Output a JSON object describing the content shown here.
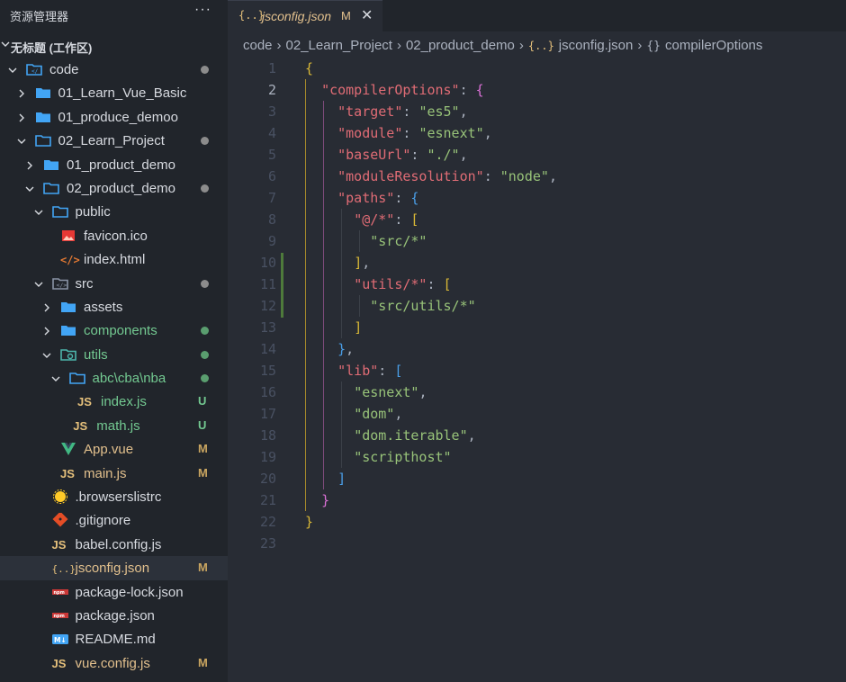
{
  "sidebar": {
    "title": "资源管理器",
    "more": "···",
    "workspace": "无标题 (工作区)",
    "items": [
      {
        "label": "code",
        "indent": 0,
        "chevron": "down",
        "icon": "folder-code",
        "color": "",
        "mark": "dot-gray"
      },
      {
        "label": "01_Learn_Vue_Basic",
        "indent": 1,
        "chevron": "right",
        "icon": "folder",
        "mark": ""
      },
      {
        "label": "01_produce_demoo",
        "indent": 1,
        "chevron": "right",
        "icon": "folder",
        "mark": ""
      },
      {
        "label": "02_Learn_Project",
        "indent": 1,
        "chevron": "down",
        "icon": "folder-open",
        "mark": "dot-gray"
      },
      {
        "label": "01_product_demo",
        "indent": 2,
        "chevron": "right",
        "icon": "folder",
        "mark": ""
      },
      {
        "label": "02_product_demo",
        "indent": 2,
        "chevron": "down",
        "icon": "folder-open",
        "mark": "dot-gray"
      },
      {
        "label": "public",
        "indent": 3,
        "chevron": "down",
        "icon": "folder-open",
        "mark": ""
      },
      {
        "label": "favicon.ico",
        "indent": 4,
        "chevron": "",
        "icon": "image",
        "mark": ""
      },
      {
        "label": "index.html",
        "indent": 4,
        "chevron": "",
        "icon": "html",
        "mark": ""
      },
      {
        "label": "src",
        "indent": 3,
        "chevron": "down",
        "icon": "folder-src",
        "mark": "dot-gray"
      },
      {
        "label": "assets",
        "indent": 4,
        "chevron": "right",
        "icon": "folder",
        "mark": ""
      },
      {
        "label": "components",
        "indent": 4,
        "chevron": "right",
        "icon": "folder",
        "mark": "dot-green",
        "color": "green"
      },
      {
        "label": "utils",
        "indent": 4,
        "chevron": "down",
        "icon": "folder-utils",
        "mark": "dot-green",
        "color": "green"
      },
      {
        "label": "abc\\cba\\nba",
        "indent": 5,
        "chevron": "down",
        "icon": "folder-open",
        "mark": "dot-green",
        "color": "green"
      },
      {
        "label": "index.js",
        "indent": 6,
        "chevron": "",
        "icon": "js",
        "mark": "U",
        "color": "green"
      },
      {
        "label": "math.js",
        "indent": 5.5,
        "chevron": "",
        "icon": "js",
        "mark": "U",
        "color": "green"
      },
      {
        "label": "App.vue",
        "indent": 4,
        "chevron": "",
        "icon": "vue",
        "mark": "M",
        "color": "amber"
      },
      {
        "label": "main.js",
        "indent": 4,
        "chevron": "",
        "icon": "js",
        "mark": "M",
        "color": "amber"
      },
      {
        "label": ".browserslistrc",
        "indent": 3,
        "chevron": "",
        "icon": "browserslist",
        "mark": ""
      },
      {
        "label": ".gitignore",
        "indent": 3,
        "chevron": "",
        "icon": "git",
        "mark": ""
      },
      {
        "label": "babel.config.js",
        "indent": 3,
        "chevron": "",
        "icon": "js",
        "mark": ""
      },
      {
        "label": "jsconfig.json",
        "indent": 3,
        "chevron": "",
        "icon": "json",
        "mark": "M",
        "color": "amber",
        "selected": true
      },
      {
        "label": "package-lock.json",
        "indent": 3,
        "chevron": "",
        "icon": "npm",
        "mark": ""
      },
      {
        "label": "package.json",
        "indent": 3,
        "chevron": "",
        "icon": "npm",
        "mark": ""
      },
      {
        "label": "README.md",
        "indent": 3,
        "chevron": "",
        "icon": "markdown",
        "mark": ""
      },
      {
        "label": "vue.config.js",
        "indent": 3,
        "chevron": "",
        "icon": "js",
        "mark": "M",
        "color": "amber"
      }
    ]
  },
  "tab": {
    "icon": "{..}",
    "name": "jsconfig.json",
    "status": "M",
    "close": "✕"
  },
  "breadcrumb": {
    "parts": [
      "code",
      "02_Learn_Project",
      "02_product_demo"
    ],
    "file_icon": "{..}",
    "file": "jsconfig.json",
    "obj_icon": "{}",
    "symbol": "compilerOptions"
  },
  "editor": {
    "active_line": 2,
    "lines": [
      {
        "n": "1",
        "html": "<span class='b1'>{</span>"
      },
      {
        "n": "2",
        "html": "  <span class='k'>\"compilerOptions\"</span><span class='p'>: </span><span class='b2'>{</span>"
      },
      {
        "n": "3",
        "html": "    <span class='k'>\"target\"</span><span class='p'>: </span><span class='s'>\"es5\"</span><span class='p'>,</span>"
      },
      {
        "n": "4",
        "html": "    <span class='k'>\"module\"</span><span class='p'>: </span><span class='s'>\"esnext\"</span><span class='p'>,</span>"
      },
      {
        "n": "5",
        "html": "    <span class='k'>\"baseUrl\"</span><span class='p'>: </span><span class='s'>\"./\"</span><span class='p'>,</span>"
      },
      {
        "n": "6",
        "html": "    <span class='k'>\"moduleResolution\"</span><span class='p'>: </span><span class='s'>\"node\"</span><span class='p'>,</span>"
      },
      {
        "n": "7",
        "html": "    <span class='k'>\"paths\"</span><span class='p'>: </span><span class='b3'>{</span>"
      },
      {
        "n": "8",
        "html": "      <span class='k'>\"@/*\"</span><span class='p'>: </span><span class='b1'>[</span>"
      },
      {
        "n": "9",
        "html": "        <span class='s'>\"src/*\"</span>"
      },
      {
        "n": "10",
        "html": "      <span class='b1'>]</span><span class='p'>,</span>"
      },
      {
        "n": "11",
        "html": "      <span class='k'>\"utils/*\"</span><span class='p'>: </span><span class='b1'>[</span>"
      },
      {
        "n": "12",
        "html": "        <span class='s'>\"src/utils/*\"</span>"
      },
      {
        "n": "13",
        "html": "      <span class='b1'>]</span>"
      },
      {
        "n": "14",
        "html": "    <span class='b3'>}</span><span class='p'>,</span>"
      },
      {
        "n": "15",
        "html": "    <span class='k'>\"lib\"</span><span class='p'>: </span><span class='b3'>[</span>"
      },
      {
        "n": "16",
        "html": "      <span class='s'>\"esnext\"</span><span class='p'>,</span>"
      },
      {
        "n": "17",
        "html": "      <span class='s'>\"dom\"</span><span class='p'>,</span>"
      },
      {
        "n": "18",
        "html": "      <span class='s'>\"dom.iterable\"</span><span class='p'>,</span>"
      },
      {
        "n": "19",
        "html": "      <span class='s'>\"scripthost\"</span>"
      },
      {
        "n": "20",
        "html": "    <span class='b3'>]</span>"
      },
      {
        "n": "21",
        "html": "  <span class='b2'>}</span>"
      },
      {
        "n": "22",
        "html": "<span class='b1'>}</span>"
      },
      {
        "n": "23",
        "html": ""
      }
    ]
  },
  "colors": {
    "folder": "#42a5f5",
    "json": "#e5c07b",
    "js": "#e5c07b",
    "vue": "#41b883",
    "npm": "#cb3837",
    "git": "#e44d26",
    "md": "#42a5f5",
    "image": "#e53935",
    "html": "#e37933"
  }
}
